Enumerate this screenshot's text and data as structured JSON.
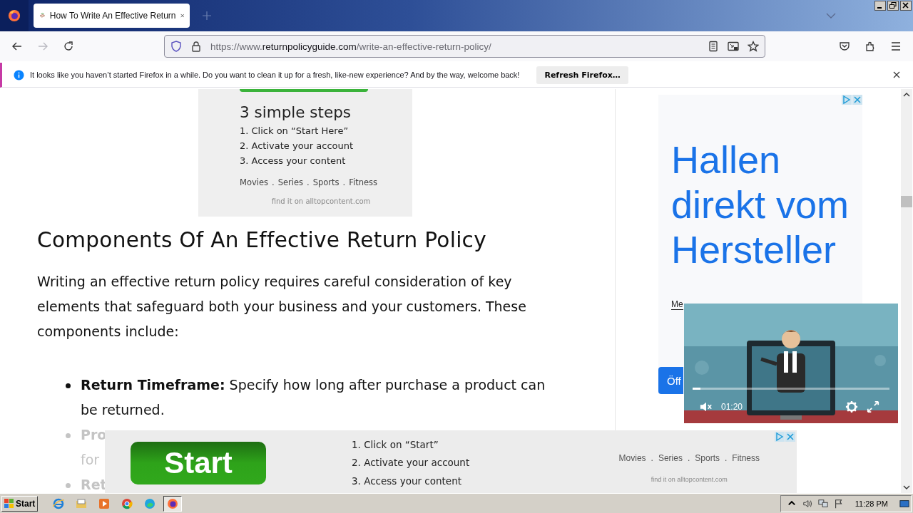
{
  "browser": {
    "tabs": [
      {
        "title": "How To Write An Effective Return",
        "selected": true
      }
    ],
    "url": {
      "prefix": "https://www.",
      "domain": "returnpolicyguide.com",
      "path": "/write-an-effective-return-policy/"
    },
    "back_disabled": false,
    "forward_disabled": true
  },
  "notification": {
    "message": "It looks like you haven’t started Firefox in a while. Do you want to clean it up for a fresh, like-new experience? And by the way, welcome back!",
    "button": "Refresh Firefox…"
  },
  "top_ad": {
    "heading": "3 simple steps",
    "steps": [
      "1. Click on “Start Here”",
      "2. Activate your account",
      "3. Access your content"
    ],
    "categories": [
      "Movies",
      ".",
      "Series",
      ".",
      "Sports",
      ".",
      "Fitness"
    ],
    "footer": "find it on alltopcontent.com"
  },
  "article": {
    "heading": "Components Of An Effective Return Policy",
    "intro": "Writing an effective return policy requires careful consideration of key elements that safeguard both your business and your customers. These components include:",
    "items": [
      {
        "text": "**Return Timeframe:** Specify how long after purchase a product can be returned.",
        "faded": false
      },
      {
        "text": "**Pro**",
        "continuation": "for",
        "faded": true
      },
      {
        "text": "**Ret**",
        "faded": true
      }
    ]
  },
  "side_ad": {
    "headline": "Hallen direkt vom Hersteller",
    "link": "Me",
    "button": "Öff"
  },
  "video": {
    "time": "01:20",
    "level": 0.04
  },
  "bottom_ad": {
    "button": "Start",
    "steps": [
      "1. Click on “Start”",
      "2. Activate your account",
      "3. Access your content"
    ],
    "categories": [
      "Movies",
      ".",
      "Series",
      ".",
      "Sports",
      ".",
      "Fitness"
    ],
    "footer": "find it on alltopcontent.com"
  },
  "taskbar": {
    "start": "Start",
    "apps": [
      {
        "kind": "ie",
        "selected": false
      },
      {
        "kind": "folder",
        "selected": false
      },
      {
        "kind": "media",
        "selected": false
      },
      {
        "kind": "chrome",
        "selected": false
      },
      {
        "kind": "edge",
        "selected": false
      },
      {
        "kind": "firefox",
        "selected": true
      }
    ],
    "clock": "11:28 PM"
  }
}
